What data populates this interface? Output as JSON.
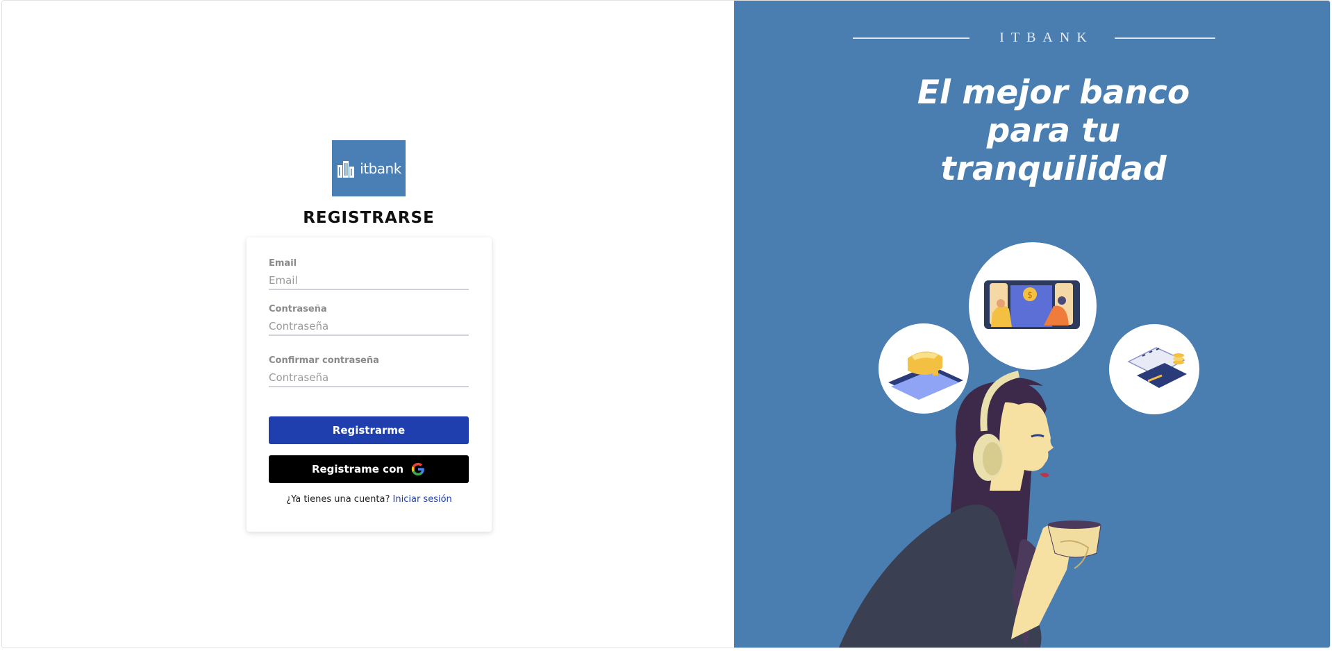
{
  "logo": {
    "text": "itbank"
  },
  "form": {
    "title": "REGISTRARSE",
    "email_label": "Email",
    "email_placeholder": "Email",
    "password_label": "Contraseña",
    "password_placeholder": "Contraseña",
    "confirm_label": "Confirmar contraseña",
    "confirm_placeholder": "Contraseña",
    "register_button": "Registrarme",
    "google_button": "Registrame con",
    "signin_prompt": "¿Ya tienes una cuenta?",
    "signin_link": "Iniciar sesión"
  },
  "promo": {
    "brand": "ITBANK",
    "headline": "El mejor banco para tu tranquilidad"
  },
  "colors": {
    "panel_blue": "#4a7db0",
    "primary_button": "#1f3fae",
    "google_button": "#000000"
  }
}
